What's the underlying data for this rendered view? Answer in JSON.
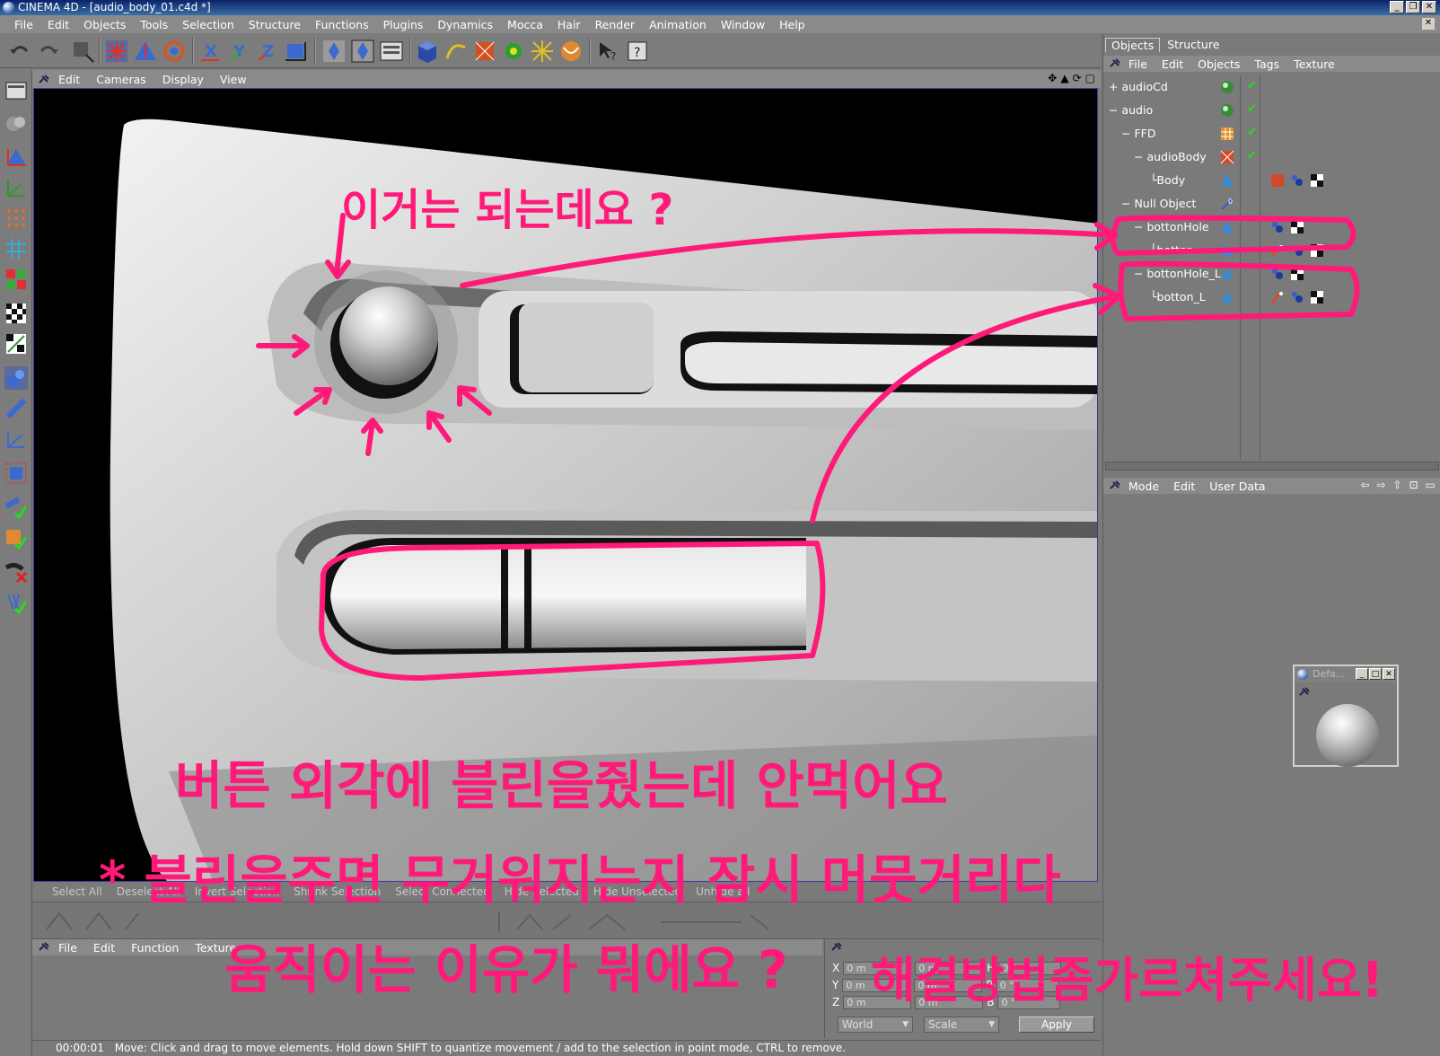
{
  "window": {
    "title": "CINEMA 4D - [audio_body_01.c4d *]",
    "buttons": [
      "_",
      "❐",
      "✕"
    ]
  },
  "menubar": [
    "File",
    "Edit",
    "Objects",
    "Tools",
    "Selection",
    "Structure",
    "Functions",
    "Plugins",
    "Dynamics",
    "Mocca",
    "Hair",
    "Render",
    "Animation",
    "Window",
    "Help"
  ],
  "viewport": {
    "menu": [
      "Edit",
      "Cameras",
      "Display",
      "View"
    ],
    "nav_icons": [
      "move-view-icon",
      "rotate-view-icon",
      "zoom-view-icon",
      "maximize-view-icon"
    ]
  },
  "selection_bar": [
    "Select All",
    "Deselect All",
    "Invert Selection",
    "Shrink Selection",
    "Select Connected",
    "Hide Selected",
    "Hide Unselected",
    "Unhide all"
  ],
  "material_manager": {
    "menu": [
      "File",
      "Edit",
      "Function",
      "Texture"
    ]
  },
  "coordinates": {
    "rows": [
      {
        "axis": "X",
        "pos": "0 m",
        "size": "0 m",
        "rot_label": "H",
        "rot": "0 °"
      },
      {
        "axis": "Y",
        "pos": "0 m",
        "size": "0 m",
        "rot_label": "P",
        "rot": "0 °"
      },
      {
        "axis": "Z",
        "pos": "0 m",
        "size": "0 m",
        "rot_label": "B",
        "rot": "0 °"
      }
    ],
    "mode_select": "World",
    "size_select": "Scale",
    "apply_label": "Apply"
  },
  "statusbar": {
    "time": "00:00:01",
    "message": "Move: Click and drag to move elements. Hold down SHIFT to quantize movement / add to the selection in point mode, CTRL to remove."
  },
  "object_manager": {
    "tabs": [
      "Objects",
      "Structure"
    ],
    "menu": [
      "File",
      "Edit",
      "Objects",
      "Tags",
      "Texture"
    ],
    "objects": [
      {
        "name": "audioCd",
        "icon": "sphere-object-icon",
        "checked": true
      },
      {
        "name": "audio",
        "icon": "sphere-object-icon",
        "checked": true
      },
      {
        "name": "FFD",
        "icon": "ffd-deformer-icon",
        "checked": true
      },
      {
        "name": "audioBody",
        "icon": "hypernurbs-icon",
        "checked": true
      },
      {
        "name": "Body",
        "icon": "polygon-object-icon",
        "checked": false
      },
      {
        "name": "Null Object",
        "icon": "null-object-icon",
        "checked": false
      },
      {
        "name": "bottonHole",
        "icon": "polygon-object-icon",
        "checked": false
      },
      {
        "name": "botten",
        "icon": "polygon-object-icon",
        "checked": false
      },
      {
        "name": "bottonHole_L",
        "icon": "polygon-object-icon",
        "checked": false
      },
      {
        "name": "botton_L",
        "icon": "polygon-object-icon",
        "checked": false
      }
    ]
  },
  "attribute_manager": {
    "menu": [
      "Mode",
      "Edit",
      "User Data"
    ]
  },
  "material_window": {
    "title": "Defa..."
  },
  "annotations": {
    "top": "이거는 되는데요 ?",
    "line1": "버튼 외각에 블린을줬는데 안먹어요",
    "line2": "* 블린을주면 무거워지는지 잠시 머뭇거리다",
    "line3": "움직이는 이유가 뭐에요 ?",
    "line4": "해결방법좀가르쳐주세요!"
  },
  "colors": {
    "annotation": "#ff1a7a",
    "ui_gray": "#7a7a7a",
    "title_bar": "#0a246a"
  }
}
